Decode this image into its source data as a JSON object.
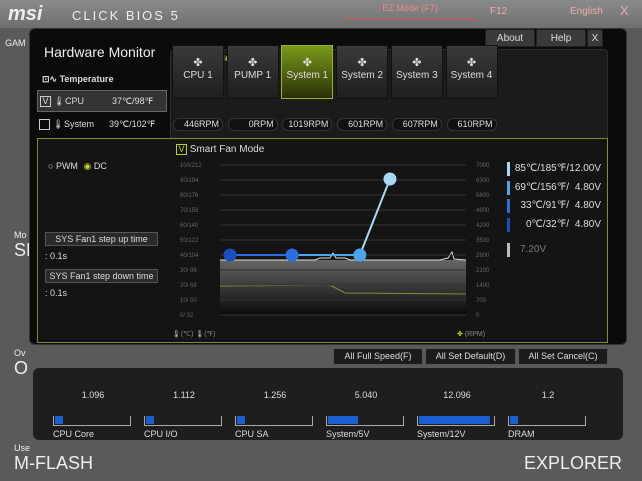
{
  "header": {
    "logo": "msi",
    "product": "CLICK BIOS 5",
    "ez_mode": "EZ Mode (F7)",
    "f12": "F12",
    "language": "English",
    "close": "X"
  },
  "background": {
    "left_labels": [
      "GAM",
      "Mo",
      "SE",
      "Ov",
      "O",
      "Use",
      "M-FLASH"
    ],
    "right_labels": [
      "E",
      "EXPLORER"
    ]
  },
  "window": {
    "title": "Hardware Monitor",
    "about": "About",
    "help": "Help",
    "close": "X",
    "breadcrumb": "Fan Control"
  },
  "temperature": {
    "label": "Temperature",
    "sensors": [
      {
        "name": "CPU",
        "value": "37℃/98℉",
        "checked": true,
        "check": "V"
      },
      {
        "name": "System",
        "value": "39℃/102℉",
        "checked": false,
        "check": ""
      }
    ]
  },
  "fans": [
    {
      "name": "CPU 1",
      "rpm": "446RPM"
    },
    {
      "name": "PUMP 1",
      "rpm": "0RPM"
    },
    {
      "name": "System 1",
      "rpm": "1019RPM",
      "selected": true
    },
    {
      "name": "System 2",
      "rpm": "601RPM"
    },
    {
      "name": "System 3",
      "rpm": "607RPM"
    },
    {
      "name": "System 4",
      "rpm": "610RPM"
    }
  ],
  "mode": {
    "pwm": "PWM",
    "dc": "DC",
    "selected": "DC"
  },
  "step": {
    "up_label": "SYS Fan1 step up time",
    "up_value": ": 0.1s",
    "down_label": "SYS Fan1 step down time",
    "down_value": ": 0.1s"
  },
  "smart_fan": {
    "label": "Smart Fan Mode",
    "check": "V"
  },
  "chart_data": {
    "type": "line",
    "left_ticks": [
      "100/212",
      "90/194",
      "80/176",
      "70/158",
      "60/140",
      "50/122",
      "40/104",
      "30/ 86",
      "20/ 68",
      "10/ 50",
      "0/ 32"
    ],
    "right_ticks": [
      "7000",
      "6300",
      "5600",
      "4900",
      "4200",
      "3500",
      "2800",
      "2100",
      "1400",
      "700",
      "0"
    ],
    "xlabel_c": "(℃)",
    "xlabel_f": "(℉)",
    "rpm_label": "(RPM)",
    "points": [
      {
        "temp": 0,
        "volt": 4.8,
        "label": "0℃/32℉/",
        "vlabel": "4.80V",
        "color": "#1a4fc0"
      },
      {
        "temp": 33,
        "volt": 4.8,
        "label": "33℃/91℉/",
        "vlabel": "4.80V",
        "color": "#2a6ee0"
      },
      {
        "temp": 69,
        "volt": 4.8,
        "label": "69℃/156℉/",
        "vlabel": "4.80V",
        "color": "#4aa4ee"
      },
      {
        "temp": 85,
        "volt": 12.0,
        "label": "85℃/185℉/",
        "vlabel": "12.00V",
        "color": "#a8d8f4"
      }
    ],
    "current_voltage": "7.20V"
  },
  "buttons": {
    "full_speed": "All Full Speed(F)",
    "set_default": "All Set Default(D)",
    "set_cancel": "All Set Cancel(C)"
  },
  "voltages": [
    {
      "name": "CPU Core",
      "value": "1.096",
      "fill": 0.1
    },
    {
      "name": "CPU I/O",
      "value": "1.112",
      "fill": 0.1
    },
    {
      "name": "CPU SA",
      "value": "1.256",
      "fill": 0.1
    },
    {
      "name": "System/5V",
      "value": "5.040",
      "fill": 0.4
    },
    {
      "name": "System/12V",
      "value": "12.096",
      "fill": 0.93
    },
    {
      "name": "DRAM",
      "value": "1.2",
      "fill": 0.1
    }
  ]
}
